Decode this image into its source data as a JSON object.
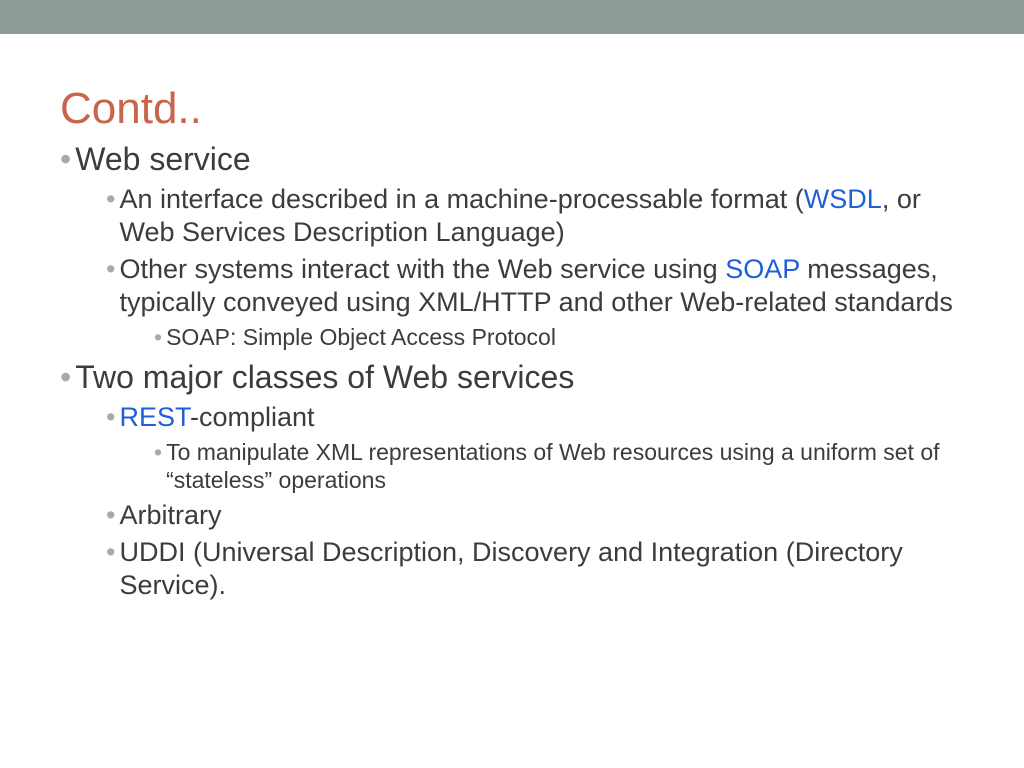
{
  "title": "Contd..",
  "b1": "Web service",
  "b1a_pre": "An interface described in a machine-processable format (",
  "b1a_link": "WSDL",
  "b1a_post": ", or Web Services Description Language)",
  "b1b_pre": "Other systems interact with the Web service using ",
  "b1b_link": "SOAP",
  "b1b_post": " messages, typically conveyed using XML/HTTP and other Web-related standards",
  "b1b_i": "SOAP: Simple Object Access Protocol",
  "b2": "Two major classes of Web services",
  "b2a_link": "REST",
  "b2a_post": "-compliant",
  "b2a_i": "To manipulate XML representations of Web resources using a uniform set of “stateless” operations",
  "b2b": "Arbitrary",
  "b2c": "UDDI (Universal Description, Discovery and Integration (Directory Service)."
}
